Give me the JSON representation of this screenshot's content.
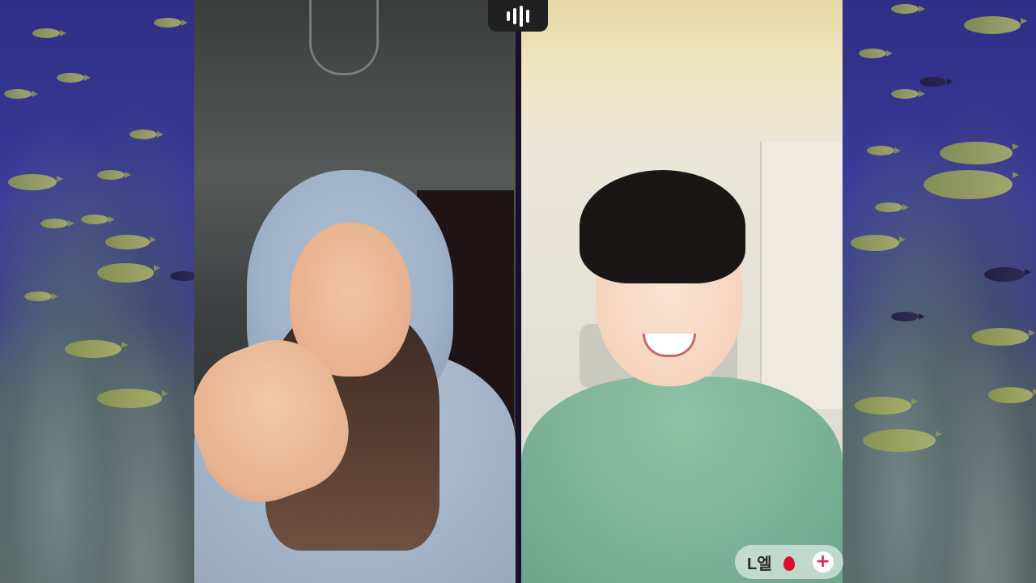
{
  "stream": {
    "audio_indicator_icon": "audio-wave-icon",
    "left_panel_label": "",
    "right_panel_label": ""
  },
  "guest_tag": {
    "username": "L엘",
    "badge_icon": "red-balloon-icon",
    "follow_icon": "plus-icon",
    "follow_symbol": "+",
    "follow_color": "#e0245e"
  },
  "colors": {
    "ocean_blue": "#34368f",
    "divider": "#1a0f2a",
    "pill_bg": "#202020"
  }
}
